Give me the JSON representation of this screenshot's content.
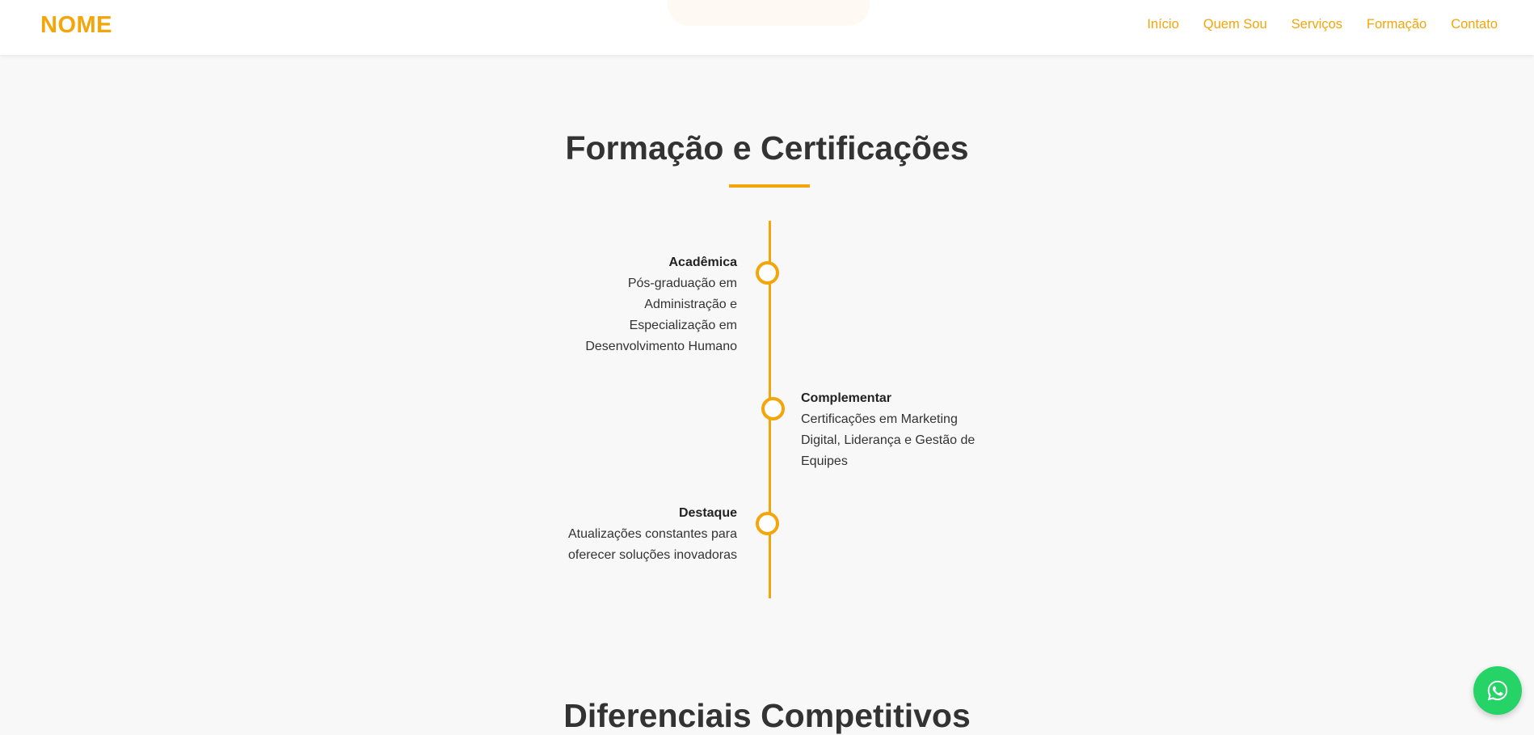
{
  "header": {
    "logo": "NOME",
    "nav": [
      "Início",
      "Quem Sou",
      "Serviços",
      "Formação",
      "Contato"
    ],
    "accent_color": "#f4a50a"
  },
  "main": {
    "section_title": "Formação e Certificações",
    "timeline": [
      {
        "heading": "Acadêmica",
        "lines": [
          "Pós-graduação em",
          "Administração e",
          "Especialização em",
          "Desenvolvimento Humano"
        ]
      },
      {
        "heading": "Complementar",
        "lines": [
          "Certificações em Marketing",
          "Digital, Liderança e Gestão de",
          "Equipes"
        ]
      },
      {
        "heading": "Destaque",
        "lines": [
          "Atualizações constantes para",
          "oferecer soluções inovadoras"
        ]
      }
    ],
    "next_section_title": "Diferenciais Competitivos"
  },
  "floating": {
    "whatsapp_icon": "whatsapp-icon",
    "whatsapp_color": "#25d366"
  }
}
